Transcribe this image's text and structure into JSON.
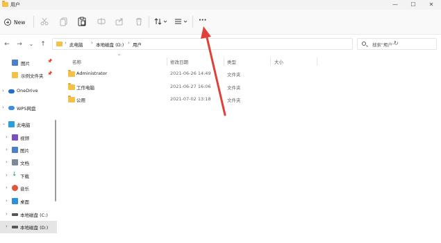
{
  "window": {
    "title": "用户",
    "minimize": "—",
    "maximize": "☐",
    "close": "✕"
  },
  "toolbar": {
    "new_label": "New",
    "more_label": "···",
    "icons": [
      "cut-icon",
      "copy-icon",
      "paste-icon",
      "rename-icon",
      "share-icon",
      "delete-icon",
      "sort-icon",
      "view-icon"
    ]
  },
  "nav": {
    "back": "←",
    "forward": "→",
    "recent": "⌄",
    "up": "↑"
  },
  "address": {
    "crumbs": [
      "此电脑",
      "本地磁盘 (D:)",
      "用户"
    ],
    "separator": "›"
  },
  "search": {
    "placeholder": "搜索\"用户\""
  },
  "sidebar": {
    "items": [
      {
        "label": "图片",
        "pinned": true,
        "icon": "pictures-icon"
      },
      {
        "label": "示例文件夹",
        "pinned": true,
        "icon": "folder-icon"
      },
      {
        "label": "OneDrive",
        "icon": "onedrive-icon"
      },
      {
        "label": "WPS网盘",
        "icon": "wps-cloud-icon"
      },
      {
        "label": "此电脑",
        "icon": "this-pc-icon",
        "expanded": true
      },
      {
        "label": "视频",
        "icon": "videos-icon"
      },
      {
        "label": "图片",
        "icon": "pictures-icon"
      },
      {
        "label": "文档",
        "icon": "documents-icon"
      },
      {
        "label": "下载",
        "icon": "downloads-icon"
      },
      {
        "label": "音乐",
        "icon": "music-icon"
      },
      {
        "label": "桌面",
        "icon": "desktop-icon"
      },
      {
        "label": "本地磁盘 (C:)",
        "icon": "drive-c-icon"
      },
      {
        "label": "本地磁盘 (D:)",
        "icon": "drive-d-icon",
        "selected": true
      }
    ]
  },
  "columns": {
    "name": "名称",
    "date": "修改日期",
    "type": "类型",
    "size": "大小"
  },
  "files": [
    {
      "name": "Administrator",
      "date": "2021-06-26 14:49",
      "type": "文件夹"
    },
    {
      "name": "工作电脑",
      "date": "2021-06-27 16:06",
      "type": "文件夹"
    },
    {
      "name": "公用",
      "date": "2021-07-02 13:18",
      "type": "文件夹"
    }
  ],
  "colors": {
    "folder": "#f3c148",
    "annotation_arrow": "#e0403a",
    "selected_bg": "#e5e5e5"
  }
}
